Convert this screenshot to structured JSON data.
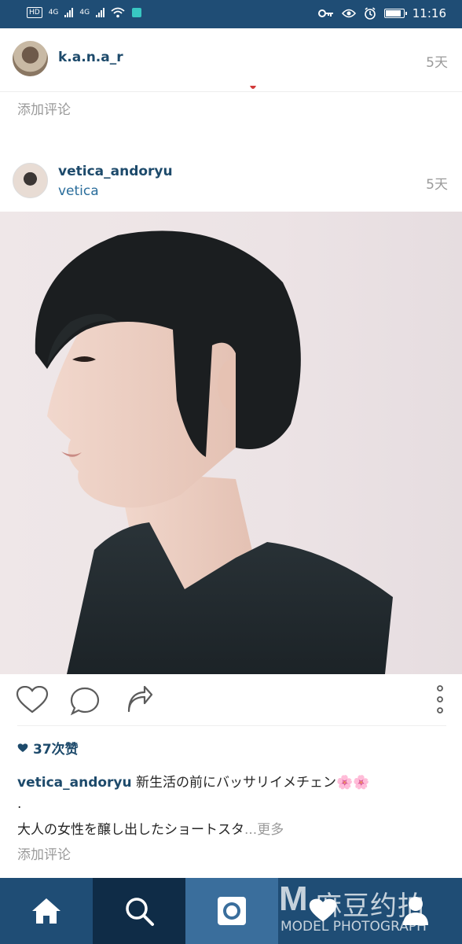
{
  "status_bar": {
    "hd": "HD",
    "net1": "4G",
    "net2": "4G",
    "time": "11:16"
  },
  "post1": {
    "username": "k.a.n.a_r",
    "time": "5天",
    "add_comment": "添加评论"
  },
  "post2": {
    "username": "vetica_andoryu",
    "location": "vetica",
    "time": "5天",
    "likes": "37次赞",
    "caption_user": "vetica_andoryu",
    "caption_text": " 新生活の前にバッサリイメチェン🌸🌸",
    "caption_dot": ".",
    "caption_line2": "大人の女性を醸し出したショートスタ",
    "caption_more": "...更多",
    "add_comment": "添加评论"
  },
  "watermark": {
    "logo": "M",
    "cn": "麻豆约拍",
    "en": "MODEL PHOTOGRAPH"
  },
  "colors": {
    "header_bar": "#1f4d75",
    "nav_active": "#0f2c47",
    "nav_camera": "#3a6e9c",
    "username": "#1d4a6b",
    "muted": "#9a9a9a"
  },
  "icons": [
    "key-icon",
    "eye-icon",
    "alarm-icon",
    "battery-icon",
    "wifi-icon",
    "heart-icon",
    "comment-icon",
    "share-icon",
    "more-icon",
    "home-icon",
    "search-icon",
    "camera-icon",
    "heart-nav-icon",
    "profile-icon"
  ]
}
